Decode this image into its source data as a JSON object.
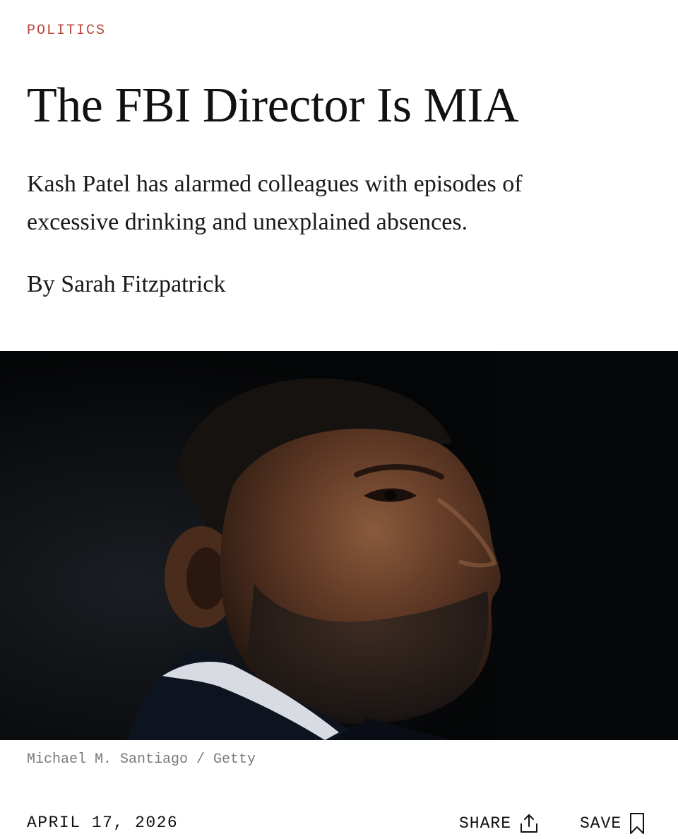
{
  "article": {
    "section": "POLITICS",
    "headline": "The FBI Director Is MIA",
    "dek": "Kash Patel has alarmed colleagues with episodes of excessive drinking and unexplained absences.",
    "byline_prefix": "By ",
    "author": "Sarah Fitzpatrick"
  },
  "hero_image": {
    "credit": "Michael M. Santiago / Getty"
  },
  "footer": {
    "date": "APRIL 17, 2026",
    "share_label": "SHARE",
    "share_icon": "share-upload-icon",
    "save_label": "SAVE",
    "save_icon": "bookmark-icon"
  },
  "colors": {
    "section_accent": "#b5473a",
    "text": "#111111",
    "credit_text": "#7a7a7a",
    "image_background": "#050608"
  }
}
